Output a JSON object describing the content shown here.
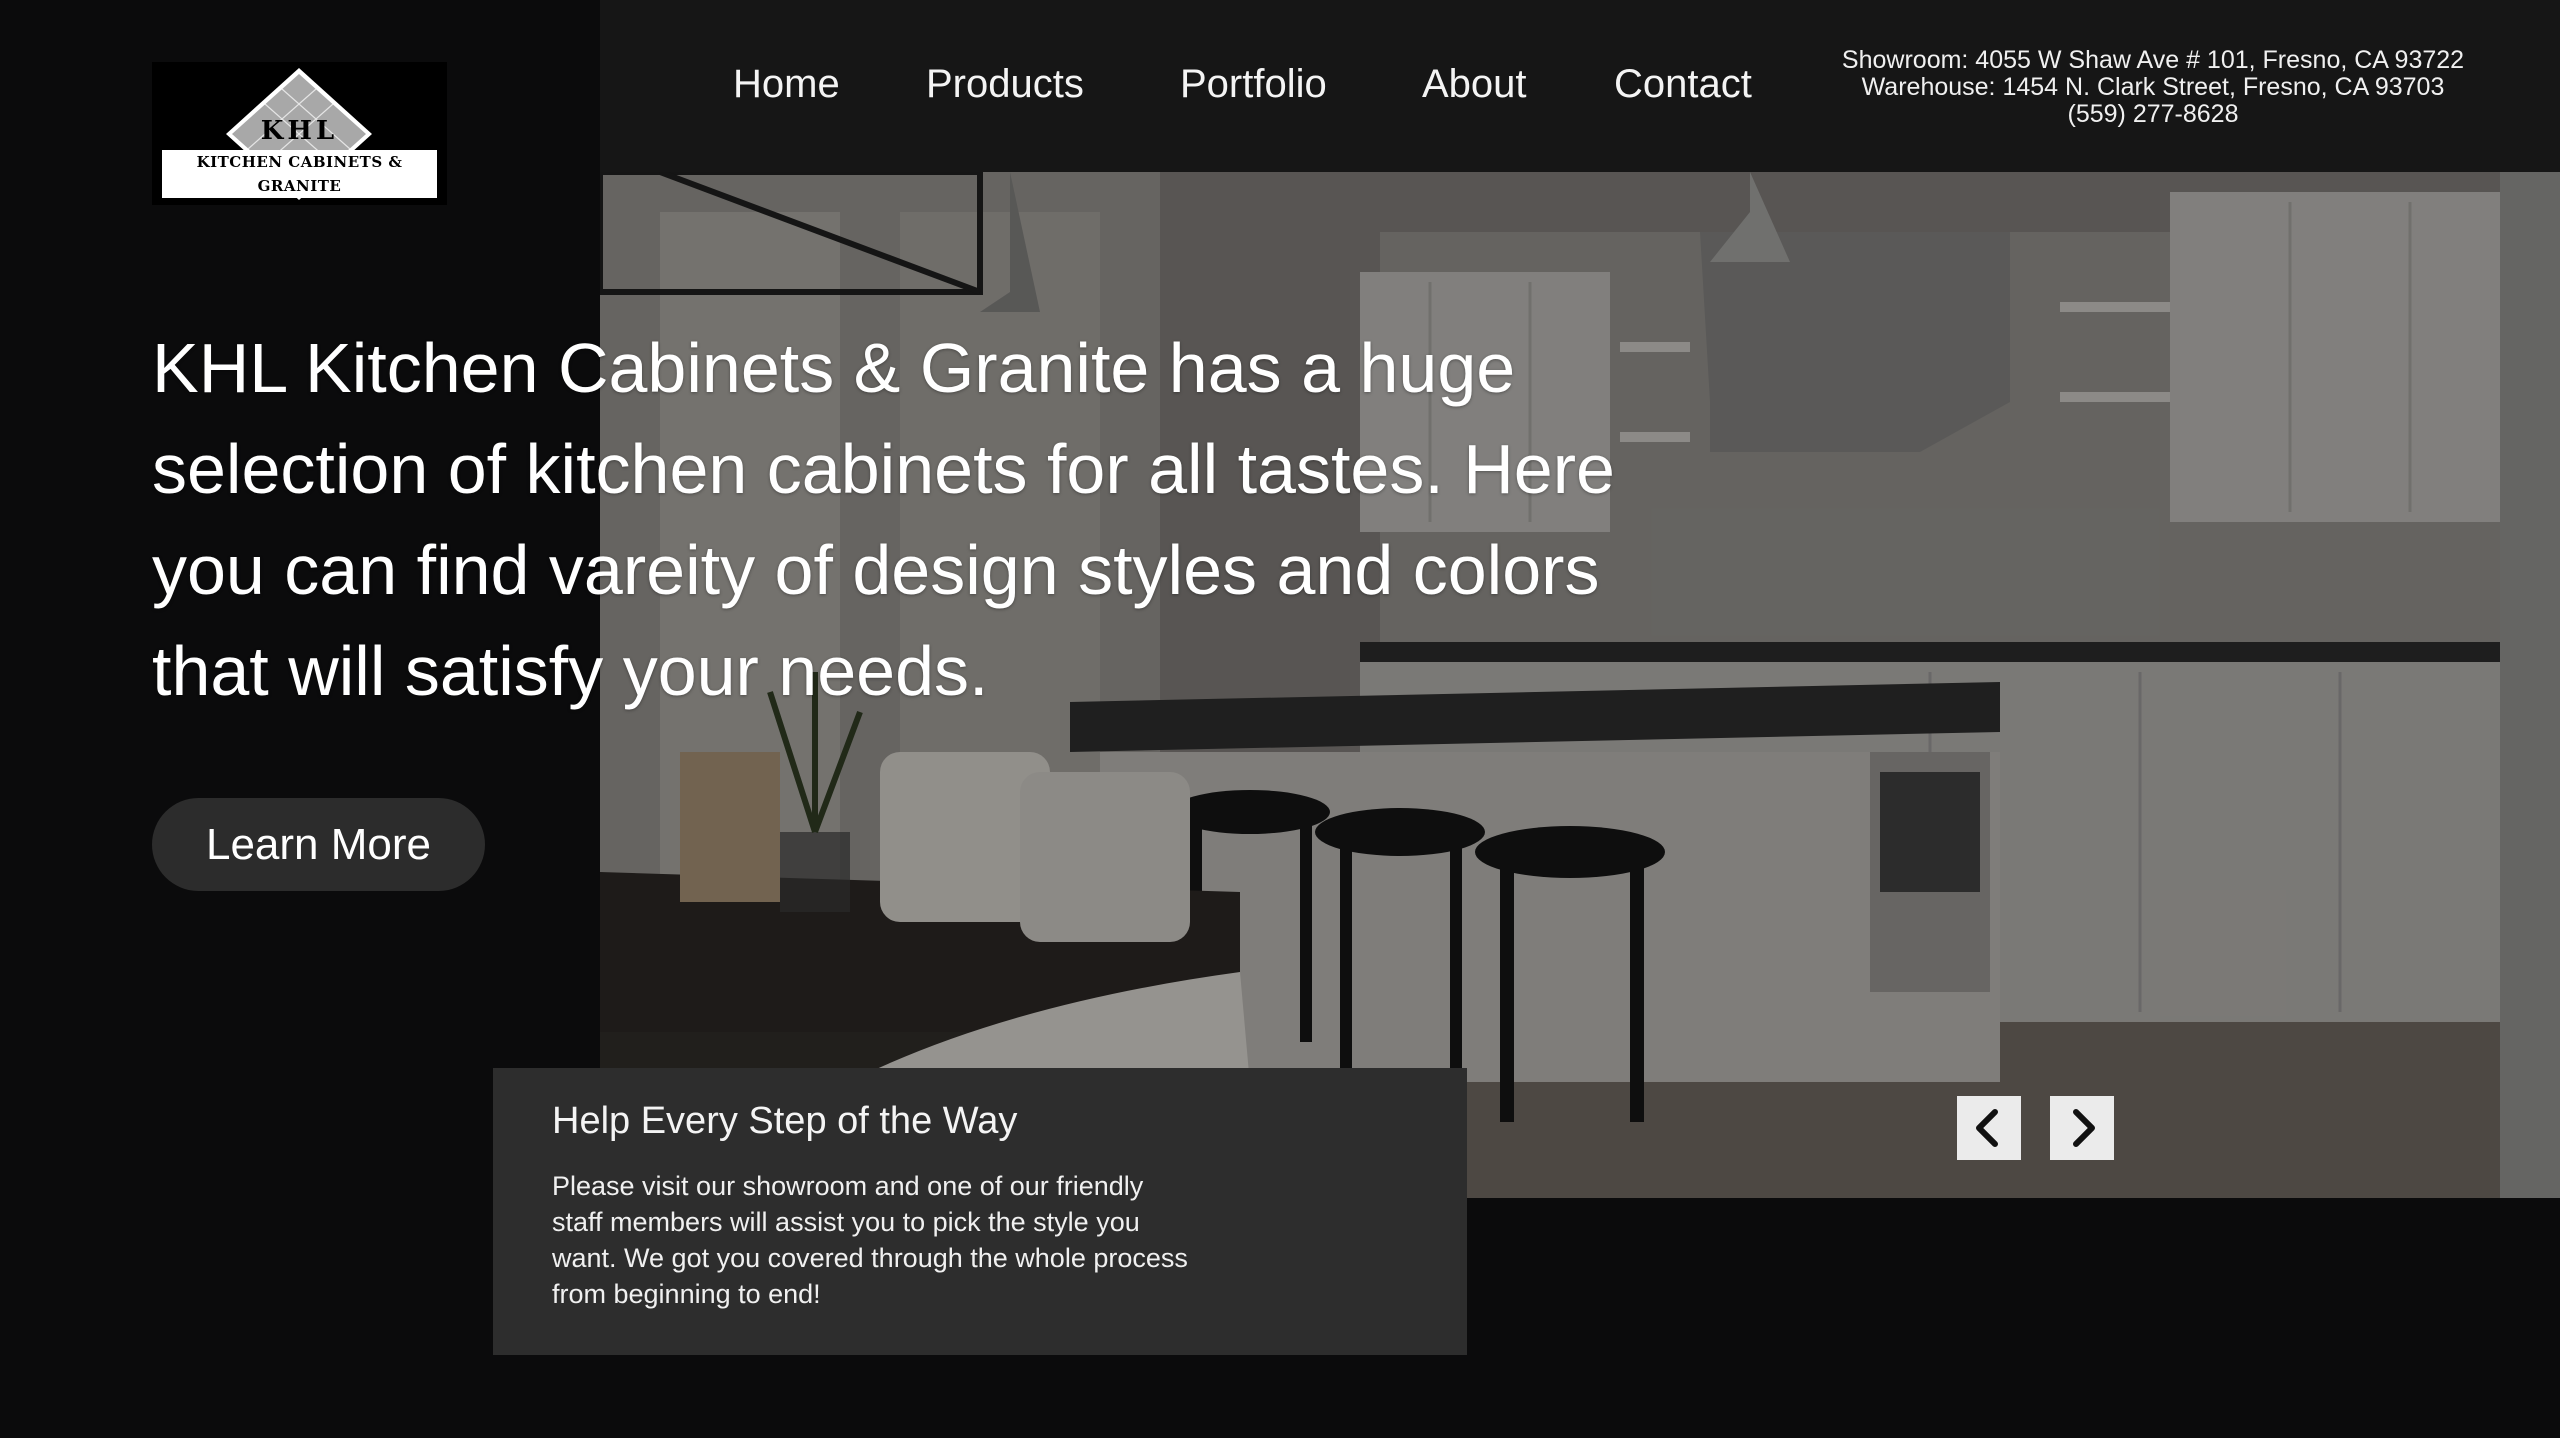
{
  "brand": {
    "monogram": "KHL",
    "name": "KITCHEN CABINETS & GRANITE",
    "colors": {
      "logo_bg": "#000000",
      "logo_diamond": "#a8a8a8"
    }
  },
  "nav": {
    "items": [
      {
        "label": "Home"
      },
      {
        "label": "Products"
      },
      {
        "label": "Portfolio"
      },
      {
        "label": "About"
      },
      {
        "label": "Contact"
      }
    ]
  },
  "contact": {
    "showroom": "Showroom: 4055 W Shaw Ave # 101, Fresno, CA 93722",
    "warehouse": "Warehouse:  1454 N. Clark Street, Fresno, CA 93703",
    "phone": "(559) 277-8628"
  },
  "hero": {
    "headline": "KHL Kitchen Cabinets & Granite has a huge selection of kitchen cabinets for all tastes. Here you can find vareity of design styles and colors that will satisfy your needs.",
    "cta_label": "Learn More"
  },
  "card": {
    "title": "Help Every Step of the Way",
    "body": "Please visit our showroom and one of our friendly staff members will assist you to pick the style you want.  We got you covered through the whole process from beginning to end!"
  },
  "slider": {
    "prev_icon": "chevron-left-icon",
    "next_icon": "chevron-right-icon"
  },
  "theme": {
    "page_bg": "#0b0b0c",
    "header_bg": "#161616",
    "button_bg": "#2c2c2c",
    "card_bg": "#2d2d2d",
    "arrow_bg": "#ebebeb"
  }
}
